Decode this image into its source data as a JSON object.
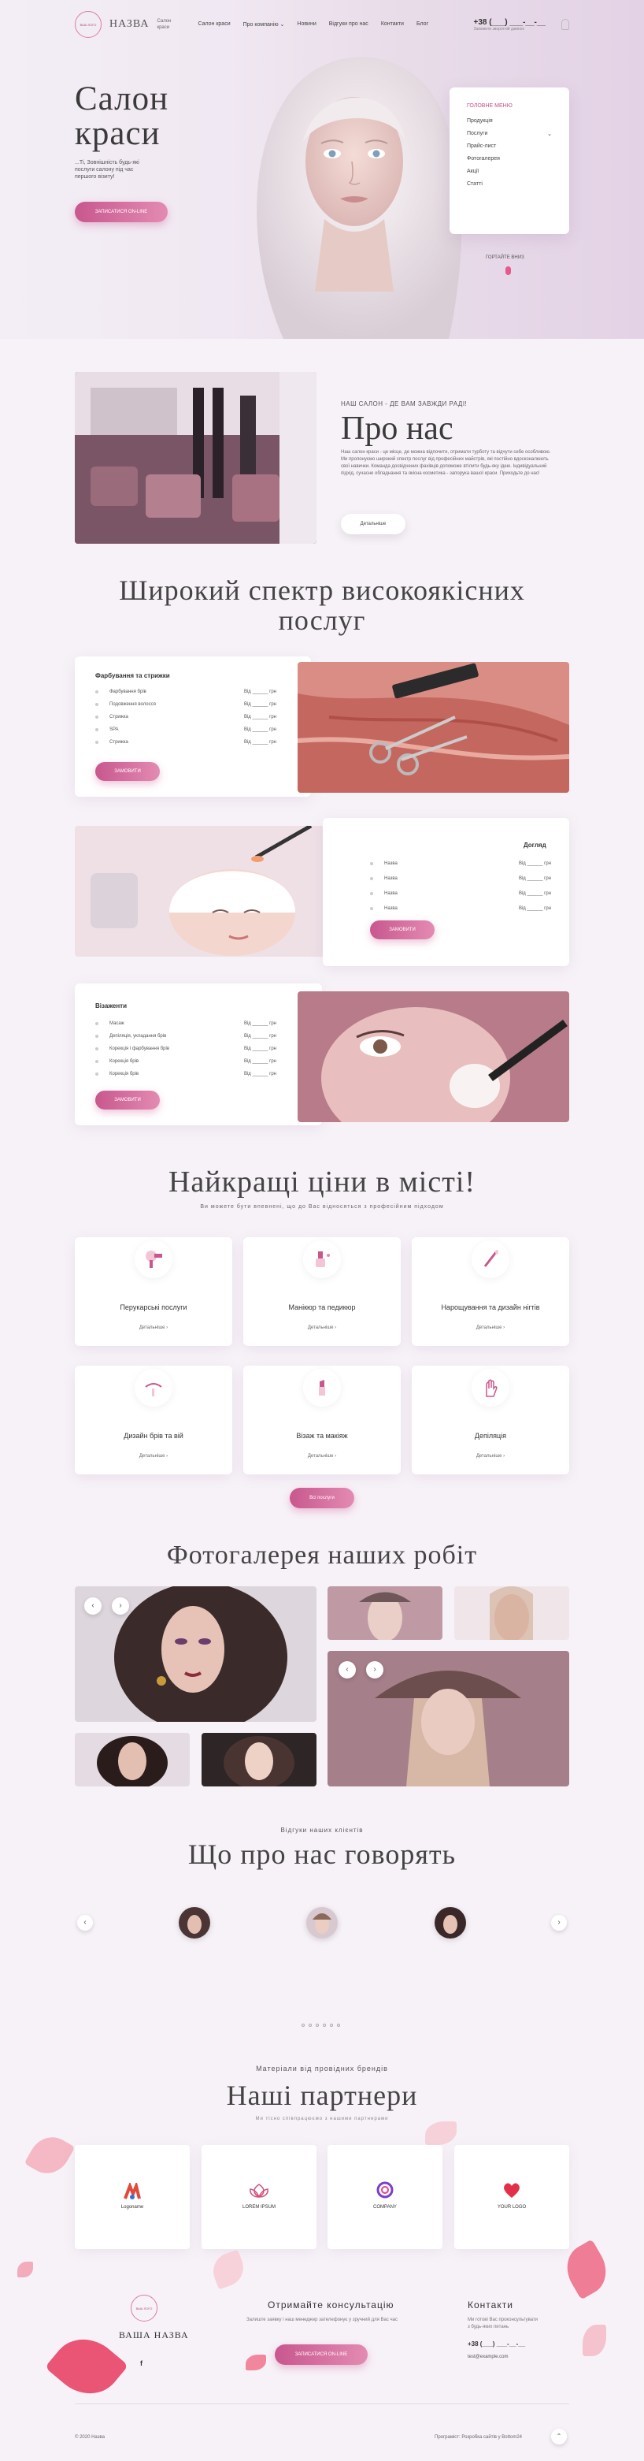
{
  "header": {
    "logo_text": "ВАШ ЛОГО",
    "brand": "НАЗВА",
    "brand_sub": "Салон краси",
    "nav": [
      "Салон краси",
      "Про компанію",
      "Новини",
      "Відгуки про нас",
      "Контакти",
      "Блог"
    ],
    "phone": "+38 (___) ___-__-__",
    "phone_sub": "Замовити зворотній дзвінок"
  },
  "hero": {
    "title_line1": "Салон",
    "title_line2": "краси",
    "text": "...Ті, Зовнішність будь-які послуги салону під час першого візиту!",
    "button": "ЗАПИСАТИСЯ ON-LINE",
    "menu_title": "ГОЛОВНЕ МЕНЮ",
    "menu_items": [
      "Продукція",
      "Послуги",
      "Прайс-лист",
      "Фотогалерея",
      "Акції",
      "Статті"
    ],
    "scroll_label": "ГОРТАЙТЕ ВНИЗ"
  },
  "about": {
    "subtitle": "НАШ САЛОН - ДЕ ВАМ ЗАВЖДИ РАДІ!",
    "title": "Про нас",
    "text": "Наш салон краси - це місце, де можна відпочити, отримати турботу та відчути себе особливою. Ми пропонуємо широкий спектр послуг від професійних майстрів, які постійно вдосконалюють свої навички. Команда досвідчених фахівців допоможе втілити будь-яку ідею. Індивідуальний підхід, сучасне обладнання та якісна косметика - запорука вашої краси. Приходьте до нас!",
    "button": "Детальніше"
  },
  "services": {
    "title_line1": "Широкий спектр високоякісних",
    "title_line2": "послуг",
    "cards": [
      {
        "heading": "Фарбування та стрижки",
        "rows": [
          {
            "name": "Фарбування брів",
            "price": "Від ______ грн"
          },
          {
            "name": "Подовження волосся",
            "price": "Від ______ грн"
          },
          {
            "name": "Стрижка",
            "price": "Від ______ грн"
          },
          {
            "name": "SPA",
            "price": "Від ______ грн"
          },
          {
            "name": "Стрижка",
            "price": "Від ______ грн"
          }
        ],
        "button": "ЗАМОВИТИ"
      },
      {
        "heading": "Догляд",
        "rows": [
          {
            "name": "Назва",
            "price": "Від ______ грн"
          },
          {
            "name": "Назва",
            "price": "Від ______ грн"
          },
          {
            "name": "Назва",
            "price": "Від ______ грн"
          },
          {
            "name": "Назва",
            "price": "Від ______ грн"
          }
        ],
        "button": "ЗАМОВИТИ"
      },
      {
        "heading": "Візаженти",
        "rows": [
          {
            "name": "Масаж",
            "price": "Від ______ грн"
          },
          {
            "name": "Депіляція, укладання брів",
            "price": "Від ______ грн"
          },
          {
            "name": "Корекція і фарбування брів",
            "price": "Від ______ грн"
          },
          {
            "name": "Корекція брів",
            "price": "Від ______ грн"
          },
          {
            "name": "Корекція брів",
            "price": "Від ______ грн"
          }
        ],
        "button": "ЗАМОВИТИ"
      }
    ]
  },
  "prices": {
    "title": "Найкращі ціни в місті!",
    "subtitle": "Ви можете бути впевнені, що до Вас відносяться з професійним підходом",
    "more_label": "Детальніше",
    "tiles": [
      {
        "title": "Перукарські послуги",
        "icon": "hairdryer-icon"
      },
      {
        "title": "Манікюр та педикюр",
        "icon": "nail-polish-icon"
      },
      {
        "title": "Нарощування та дизайн нігтів",
        "icon": "nail-brush-icon"
      },
      {
        "title": "Дизайн брів та вій",
        "icon": "eyebrow-icon"
      },
      {
        "title": "Візаж та макіяж",
        "icon": "lipstick-icon"
      },
      {
        "title": "Депіляція",
        "icon": "hand-icon"
      }
    ],
    "button": "Всі послуги"
  },
  "gallery": {
    "title": "Фотогалерея наших робіт"
  },
  "reviews": {
    "subtitle": "Відгуки наших клієнтів",
    "title": "Що про нас говорять"
  },
  "partners": {
    "subtitle": "Матеріали від провідних брендів",
    "title": "Наші партнери",
    "text": "Ми тісно співпрацюємо з нашими партнерами",
    "logos": [
      "Logoname",
      "LOREM IPSUM",
      "COMPANY",
      "YOUR LOGO"
    ]
  },
  "footer": {
    "brand": "ВАША НАЗВА",
    "logo_text": "ВАШ ЛОГО",
    "consult_title": "Отримайте консультацію",
    "consult_text": "Залиште заявку і наш менеджер зателефонує у зручний для Вас час",
    "consult_button": "ЗАПИСАТИСЯ ON-LINE",
    "contacts_title": "Контакти",
    "contacts_text": "Ми готові Вас проконсультувати з будь-яких питань",
    "phone": "+38 (___) ___-__-__",
    "email": "test@example.com",
    "copyright": "© 2020 Назва",
    "credits": "Програміст: Розробка сайтів у Bottom24"
  },
  "colors": {
    "accent": "#c8578e",
    "accent_light": "#e38bb2",
    "bg": "#f7f2f8"
  }
}
